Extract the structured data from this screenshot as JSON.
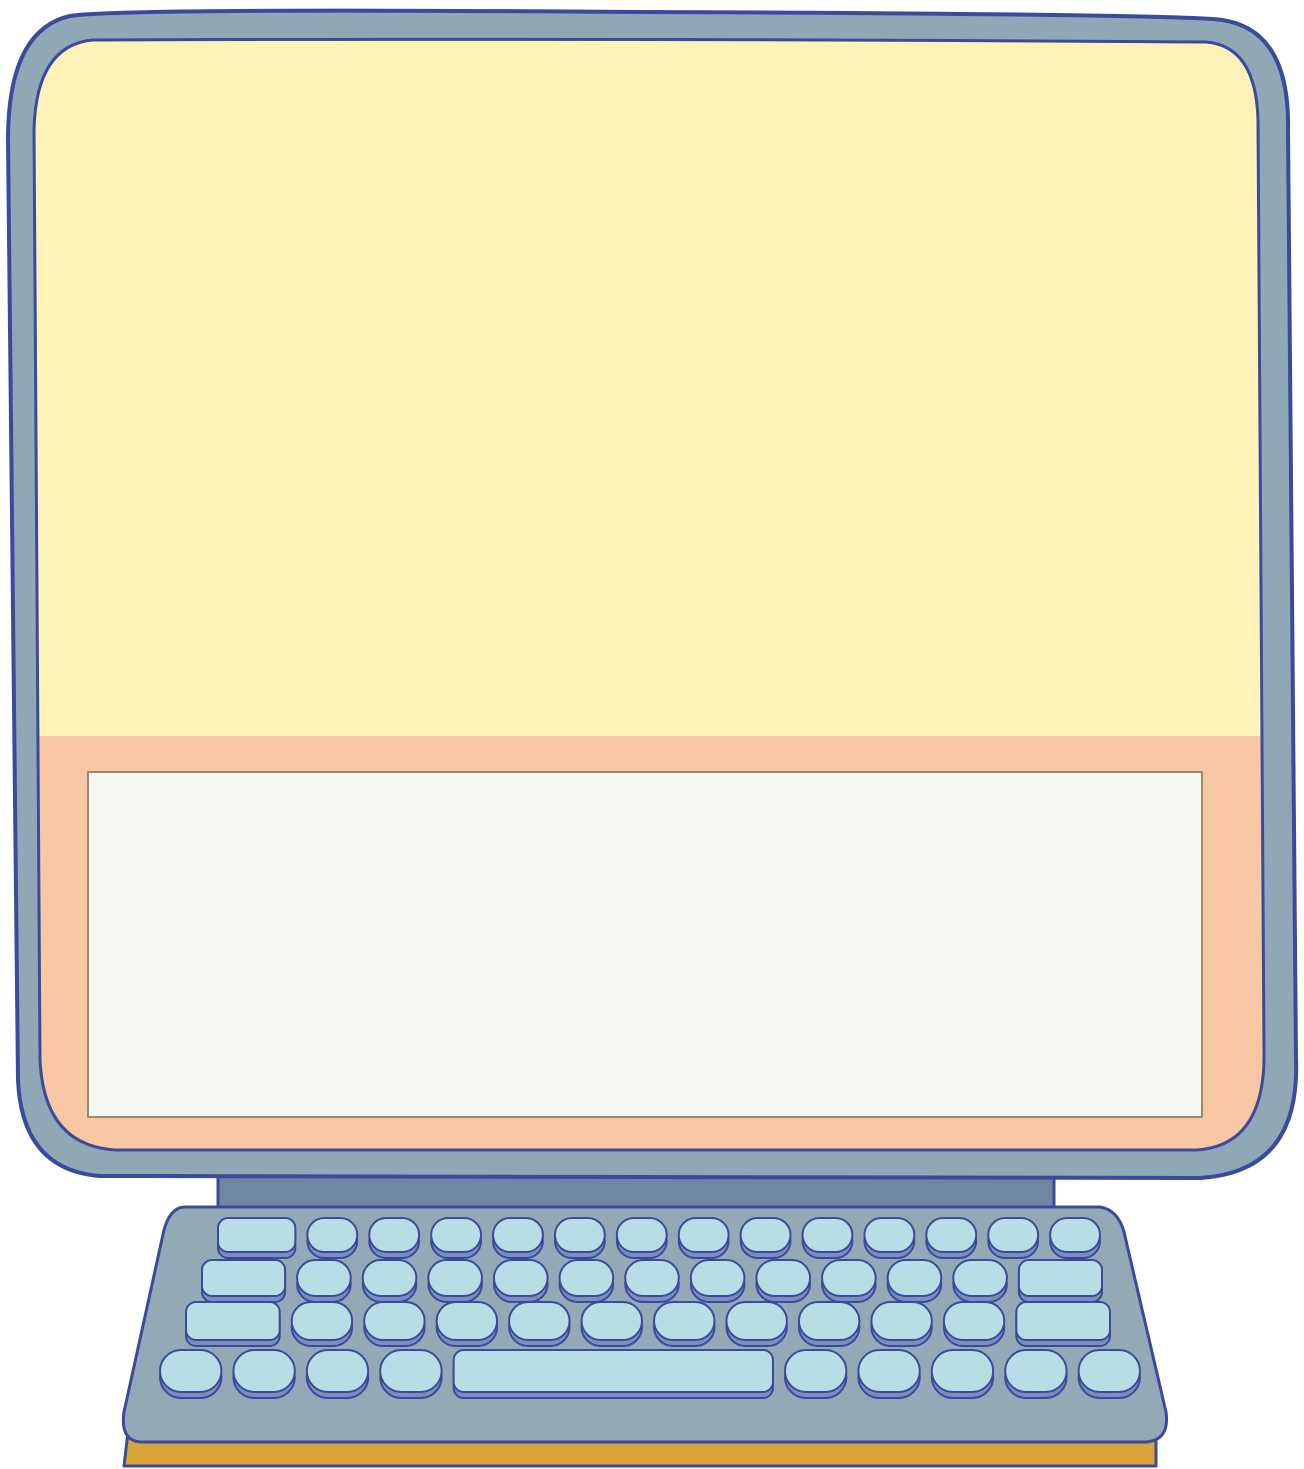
{
  "illustration": {
    "subject": "computer-monitor-with-keyboard",
    "colors": {
      "outline": "#3b4a9c",
      "bezel": "#90a8b6",
      "stand": "#6f87a3",
      "screen_top": "#fdf2b8",
      "screen_band": "#f8c8a5",
      "text_panel": "#f5f5f2",
      "text_panel_border": "#9a8870",
      "keyboard_body": "#94a9b6",
      "key_top": "#b8dde4",
      "key_side": "#7a8fc0",
      "base": "#d8a43a"
    }
  },
  "keyboard": {
    "rows": [
      [
        "wide",
        "round",
        "round",
        "round",
        "round",
        "round",
        "round",
        "round",
        "round",
        "round",
        "round",
        "round",
        "round",
        "round"
      ],
      [
        "wide",
        "round",
        "round",
        "round",
        "round",
        "round",
        "round",
        "round",
        "round",
        "round",
        "round",
        "round",
        "wide"
      ],
      [
        "wide",
        "round",
        "round",
        "round",
        "round",
        "round",
        "round",
        "round",
        "round",
        "round",
        "round",
        "wide"
      ],
      [
        "round",
        "round",
        "round",
        "round",
        "space",
        "round",
        "round",
        "round",
        "round",
        "round"
      ]
    ]
  }
}
